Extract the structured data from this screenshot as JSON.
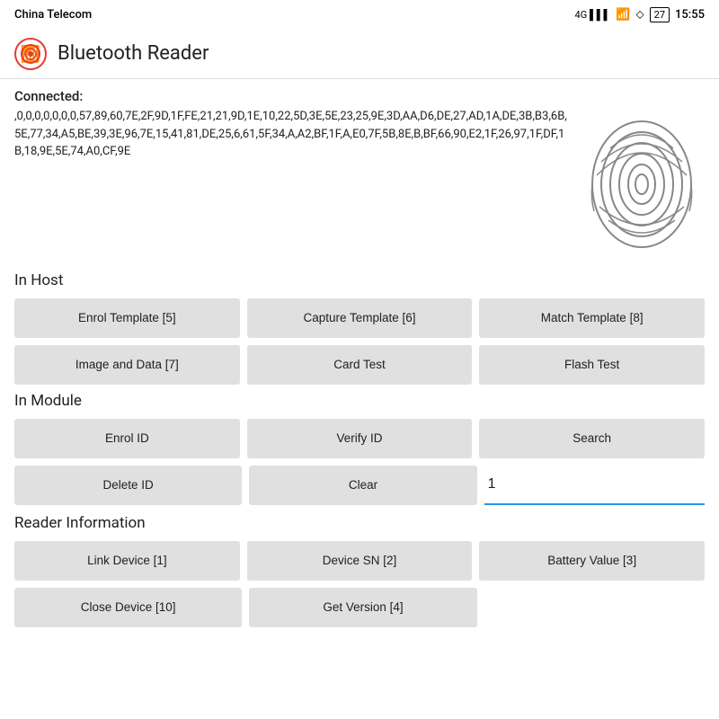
{
  "statusBar": {
    "carrier": "China Telecom",
    "signal": "4G",
    "wifi": "WiFi",
    "bluetooth": "BT",
    "battery": "27",
    "time": "15:55"
  },
  "appBar": {
    "title": "Bluetooth Reader"
  },
  "connected": {
    "label": "Connected:",
    "hexData": ",0,0,0,0,0,0,0,57,89,60,7E,2F,9D,1F,FE,21,21,9D,1E,10,22,5D,3E,5E,23,25,9E,3D,AA,D6,DE,27,AD,1A,DE,3B,B3,6B,5E,77,34,A5,BE,39,3E,96,7E,15,41,81,DE,25,6,61,5F,34,A,A2,BF,1F,A,E0,7F,5B,8E,B,BF,66,90,E2,1F,26,97,1F,DF,1B,18,9E,5E,74,A0,CF,9E"
  },
  "sections": {
    "inHost": {
      "label": "In Host",
      "row1": [
        {
          "id": "enrol-template",
          "label": "Enrol Template [5]"
        },
        {
          "id": "capture-template",
          "label": "Capture Template [6]"
        },
        {
          "id": "match-template",
          "label": "Match Template [8]"
        }
      ],
      "row2": [
        {
          "id": "image-and-data",
          "label": "Image and Data [7]"
        },
        {
          "id": "card-test",
          "label": "Card Test"
        },
        {
          "id": "flash-test",
          "label": "Flash Test"
        }
      ]
    },
    "inModule": {
      "label": "In Module",
      "row1": [
        {
          "id": "enrol-id",
          "label": "Enrol ID"
        },
        {
          "id": "verify-id",
          "label": "Verify ID"
        },
        {
          "id": "search",
          "label": "Search"
        }
      ],
      "row2": [
        {
          "id": "delete-id",
          "label": "Delete ID"
        },
        {
          "id": "clear",
          "label": "Clear"
        }
      ],
      "inputValue": "1",
      "inputPlaceholder": ""
    },
    "readerInfo": {
      "label": "Reader Information",
      "row1": [
        {
          "id": "link-device",
          "label": "Link Device [1]"
        },
        {
          "id": "device-sn",
          "label": "Device SN [2]"
        },
        {
          "id": "battery-value",
          "label": "Battery Value [3]"
        }
      ],
      "row2": [
        {
          "id": "close-device",
          "label": "Close Device [10]"
        },
        {
          "id": "get-version",
          "label": "Get Version [4]"
        }
      ]
    }
  }
}
